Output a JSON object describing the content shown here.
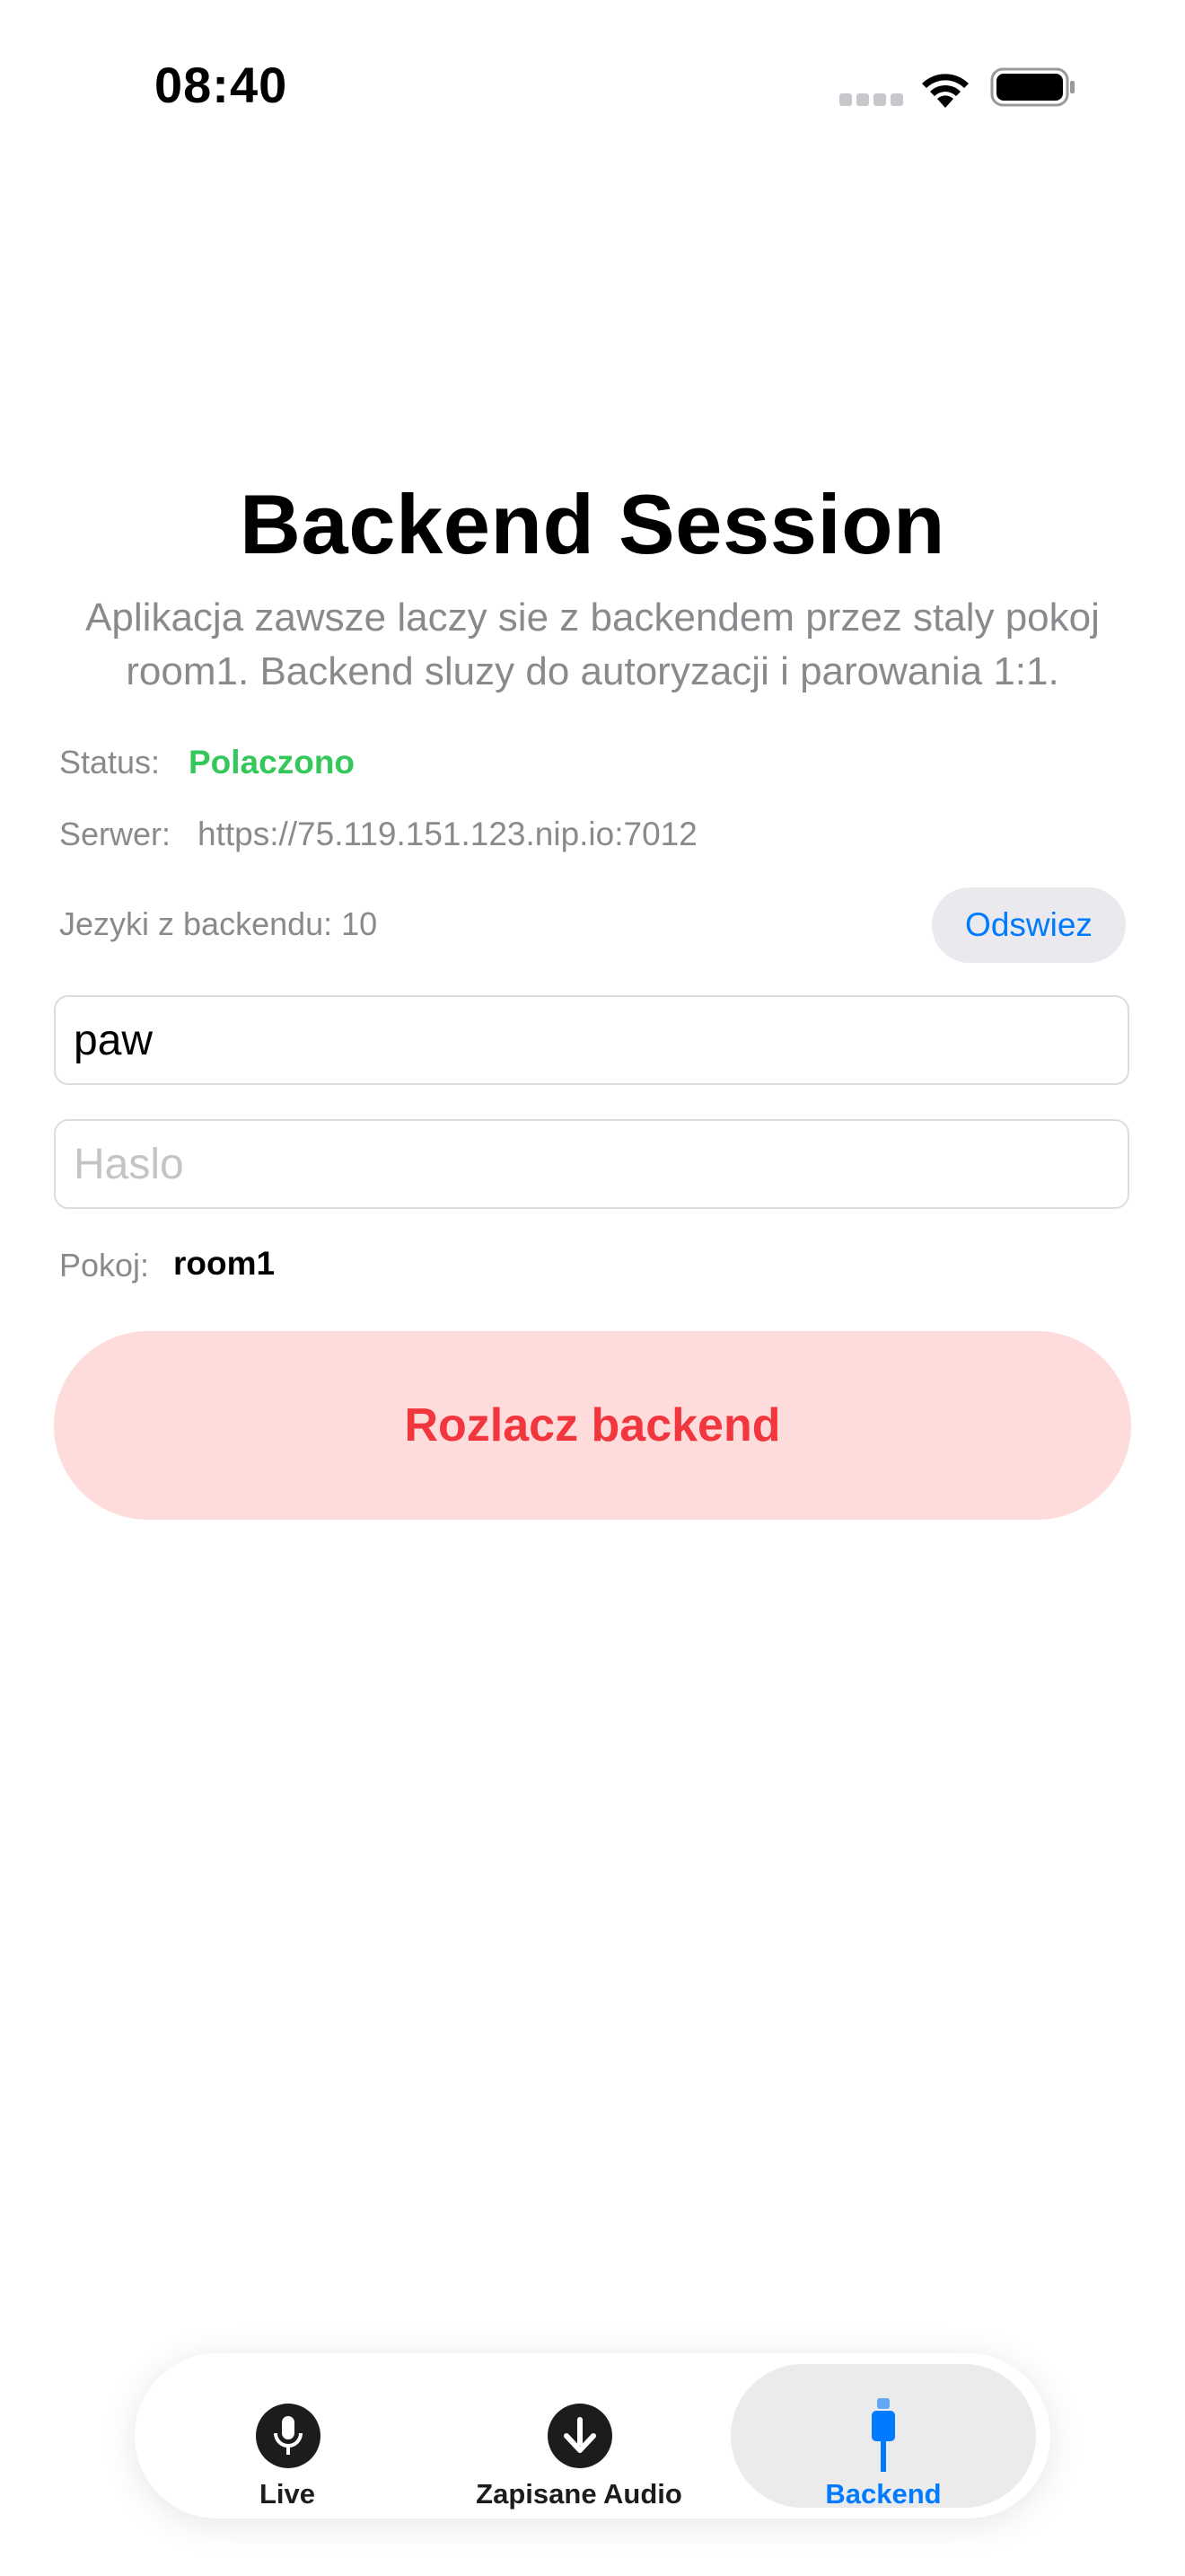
{
  "status_bar": {
    "time": "08:40"
  },
  "page": {
    "title": "Backend Session",
    "subtitle": "Aplikacja zawsze laczy sie z backendem przez staly pokoj room1. Backend sluzy do autoryzacji i parowania 1:1."
  },
  "status": {
    "label": "Status:",
    "value": "Polaczono",
    "value_color": "#34c759"
  },
  "server": {
    "label": "Serwer:",
    "value": "https://75.119.151.123.nip.io:7012"
  },
  "languages": {
    "label": "Jezyki z backendu: 10",
    "refresh_label": "Odswiez"
  },
  "username": {
    "value": "paw",
    "placeholder": ""
  },
  "password": {
    "value": "",
    "placeholder": "Haslo"
  },
  "room": {
    "label": "Pokoj:",
    "value": "room1"
  },
  "disconnect_button": {
    "label": "Rozlacz backend",
    "color": "#f2363d"
  },
  "tab_bar": {
    "selected": "Backend",
    "accent": "#007aff",
    "tabs": [
      {
        "label": "Live",
        "icon": "microphone-icon"
      },
      {
        "label": "Zapisane Audio",
        "icon": "download-arrow-icon"
      },
      {
        "label": "Backend",
        "icon": "plug-icon"
      }
    ]
  }
}
